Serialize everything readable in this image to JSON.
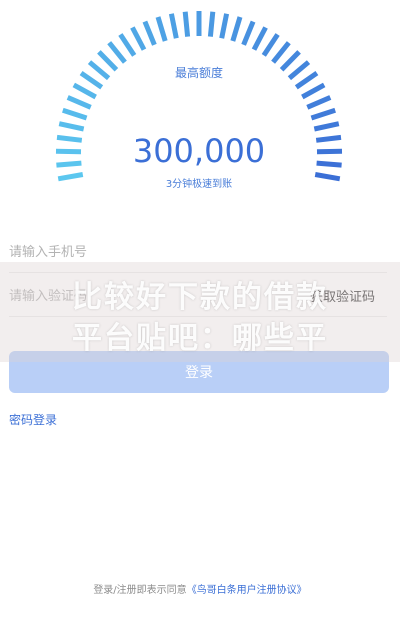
{
  "gauge": {
    "label": "最高额度",
    "amount": "300,000",
    "subtitle": "3分钟极速到账",
    "colors": {
      "start": "#5cc7ef",
      "end": "#3b6fd6"
    }
  },
  "form": {
    "phone_placeholder": "请输入手机号",
    "code_placeholder": "请输入验证码",
    "get_code_label": "获取验证码",
    "login_button": "登录",
    "password_login": "密码登录"
  },
  "watermark": {
    "line1": "比较好下款的借款",
    "line2": "平台贴吧：哪些平"
  },
  "footer": {
    "agreement_prefix": "登录/注册即表示同意",
    "agreement_link": "《鸟哥白条用户注册协议》"
  }
}
